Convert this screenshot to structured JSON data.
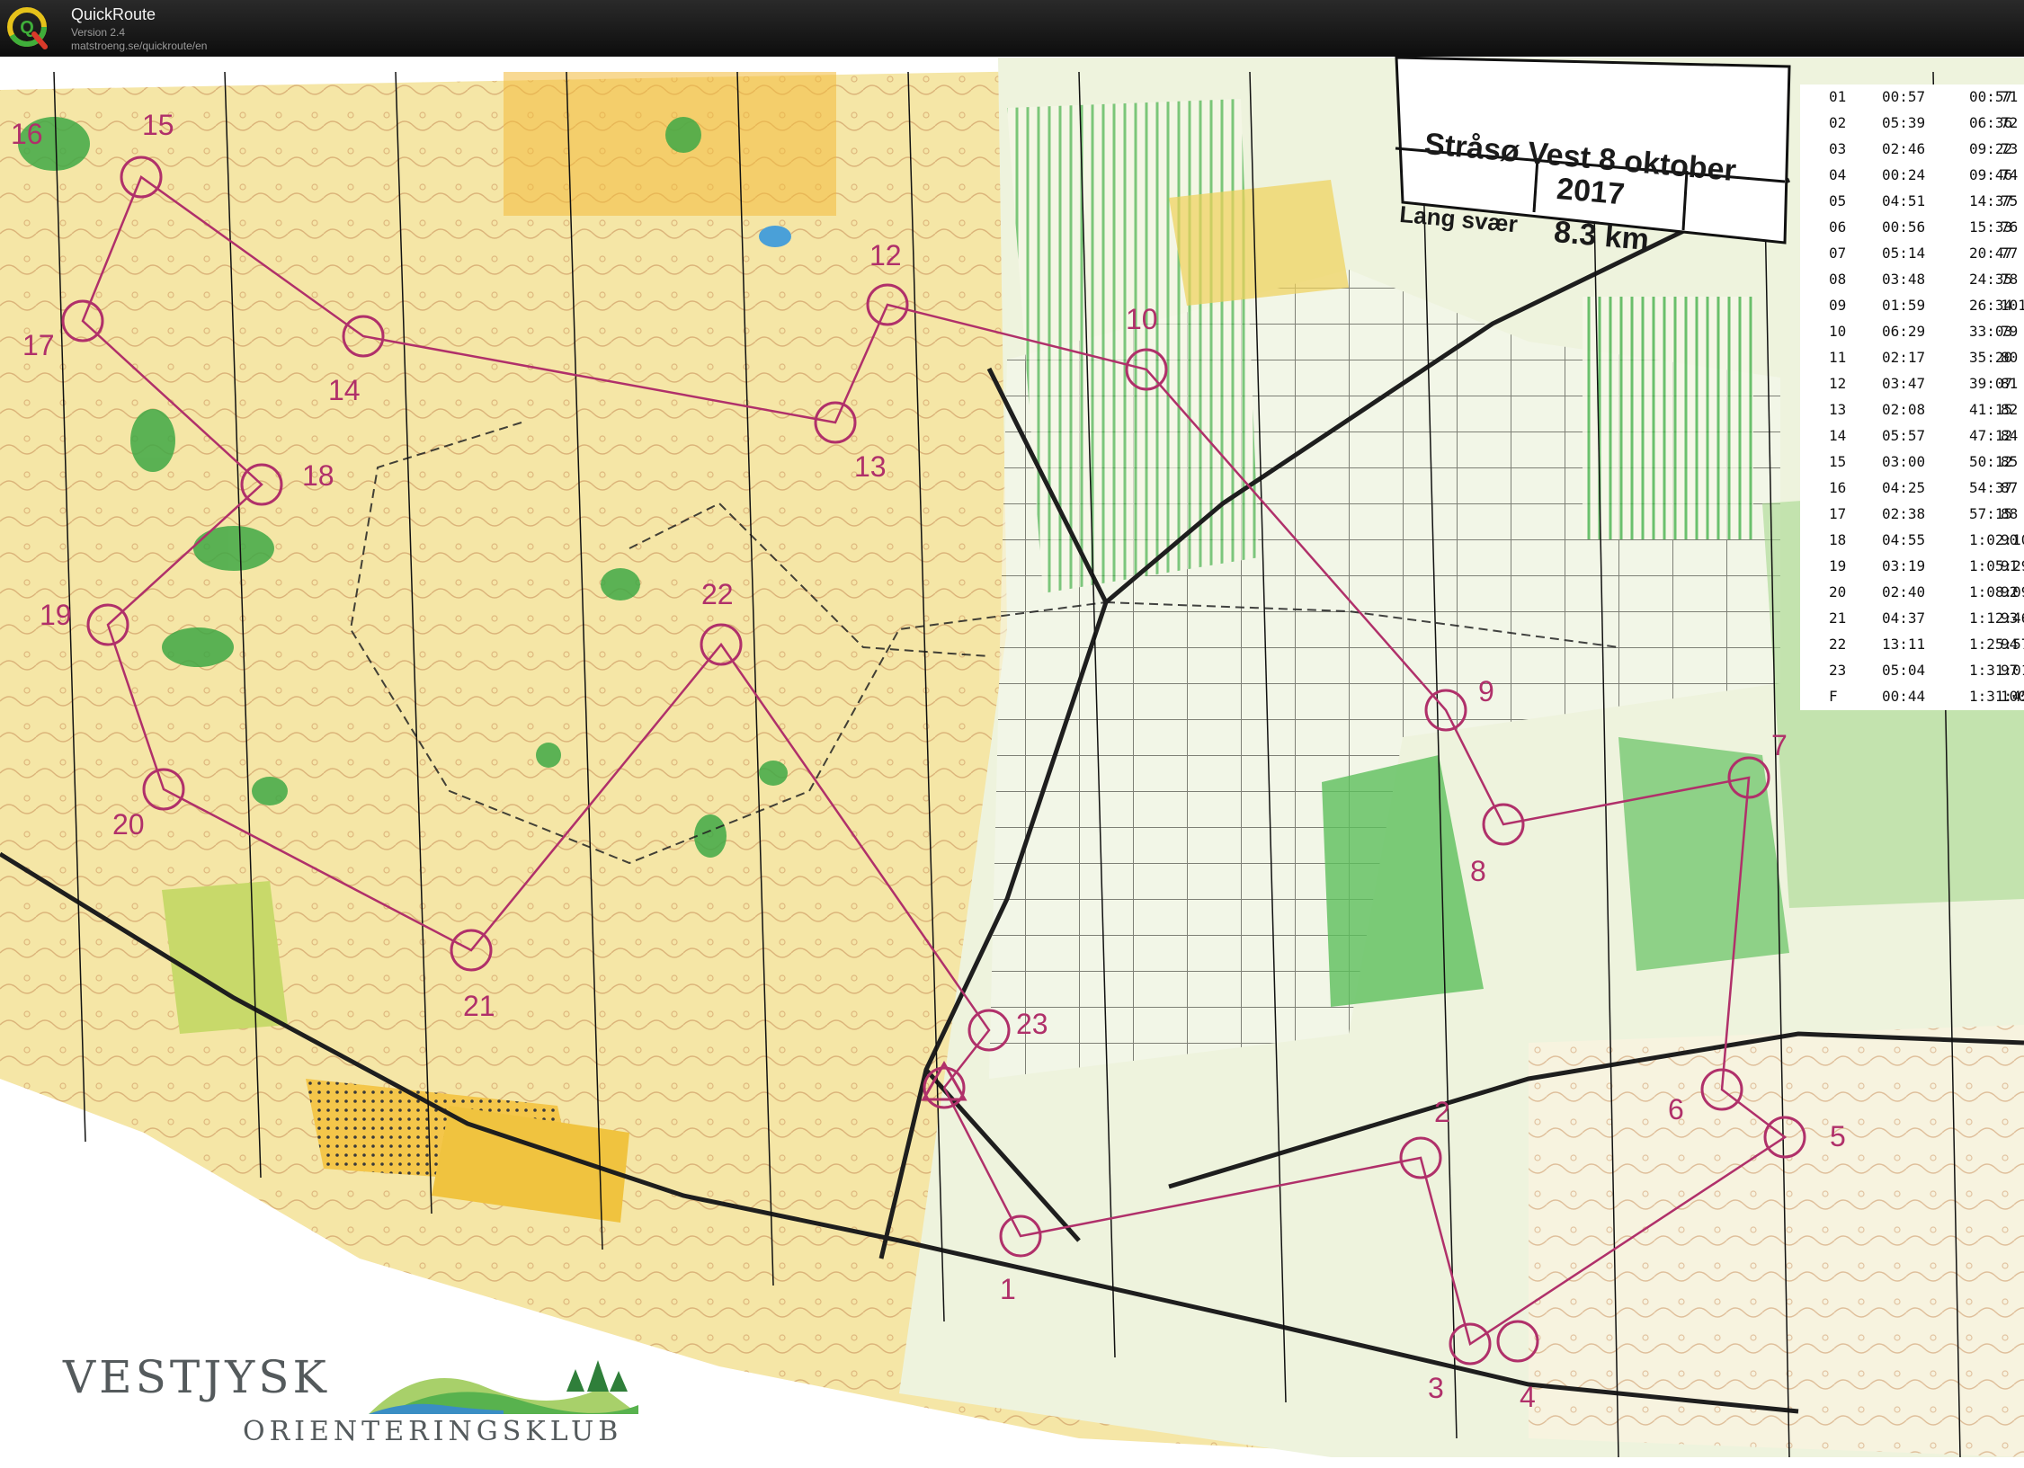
{
  "app": {
    "title": "QuickRoute",
    "version": "Version 2.4",
    "url": "matstroeng.se/quickroute/en",
    "logo_letter": "Q",
    "logo_icon": "quickroute-logo-icon"
  },
  "map": {
    "title_line1": "Stråsø Vest 8 oktober",
    "title_line2": "2017",
    "course_name": "Lang svær",
    "course_distance": "8.3 km",
    "course_color": "#b0306a",
    "controls": [
      {
        "label": "1"
      },
      {
        "label": "2"
      },
      {
        "label": "3"
      },
      {
        "label": "4"
      },
      {
        "label": "5"
      },
      {
        "label": "6"
      },
      {
        "label": "7"
      },
      {
        "label": "8"
      },
      {
        "label": "9"
      },
      {
        "label": "10"
      },
      {
        "label": "12"
      },
      {
        "label": "13"
      },
      {
        "label": "14"
      },
      {
        "label": "15"
      },
      {
        "label": "16"
      },
      {
        "label": "17"
      },
      {
        "label": "18"
      },
      {
        "label": "19"
      },
      {
        "label": "20"
      },
      {
        "label": "21"
      },
      {
        "label": "22"
      },
      {
        "label": "23"
      }
    ],
    "club": {
      "name": "VESTJYSK",
      "subtitle": "ORIENTERINGSKLUB"
    }
  },
  "splits": [
    {
      "control": "01",
      "split": "00:57",
      "total": "00:57",
      "place": "71"
    },
    {
      "control": "02",
      "split": "05:39",
      "total": "06:36",
      "place": "72"
    },
    {
      "control": "03",
      "split": "02:46",
      "total": "09:22",
      "place": "73"
    },
    {
      "control": "04",
      "split": "00:24",
      "total": "09:46",
      "place": "74"
    },
    {
      "control": "05",
      "split": "04:51",
      "total": "14:37",
      "place": "75"
    },
    {
      "control": "06",
      "split": "00:56",
      "total": "15:33",
      "place": "76"
    },
    {
      "control": "07",
      "split": "05:14",
      "total": "20:47",
      "place": "77"
    },
    {
      "control": "08",
      "split": "03:48",
      "total": "24:35",
      "place": "78"
    },
    {
      "control": "09",
      "split": "01:59",
      "total": "26:34",
      "place": "101"
    },
    {
      "control": "10",
      "split": "06:29",
      "total": "33:03",
      "place": "79"
    },
    {
      "control": "11",
      "split": "02:17",
      "total": "35:20",
      "place": "80"
    },
    {
      "control": "12",
      "split": "03:47",
      "total": "39:07",
      "place": "81"
    },
    {
      "control": "13",
      "split": "02:08",
      "total": "41:15",
      "place": "82"
    },
    {
      "control": "14",
      "split": "05:57",
      "total": "47:12",
      "place": "84"
    },
    {
      "control": "15",
      "split": "03:00",
      "total": "50:12",
      "place": "85"
    },
    {
      "control": "16",
      "split": "04:25",
      "total": "54:37",
      "place": "87"
    },
    {
      "control": "17",
      "split": "02:38",
      "total": "57:15",
      "place": "88"
    },
    {
      "control": "18",
      "split": "04:55",
      "total": "1:02:10",
      "place": "90"
    },
    {
      "control": "19",
      "split": "03:19",
      "total": "1:05:29",
      "place": "91"
    },
    {
      "control": "20",
      "split": "02:40",
      "total": "1:08:09",
      "place": "92"
    },
    {
      "control": "21",
      "split": "04:37",
      "total": "1:12:46",
      "place": "93"
    },
    {
      "control": "22",
      "split": "13:11",
      "total": "1:25:57",
      "place": "94"
    },
    {
      "control": "23",
      "split": "05:04",
      "total": "1:31:01",
      "place": "97"
    },
    {
      "control": "F",
      "split": "00:44",
      "total": "1:31:45",
      "place": "100"
    }
  ]
}
